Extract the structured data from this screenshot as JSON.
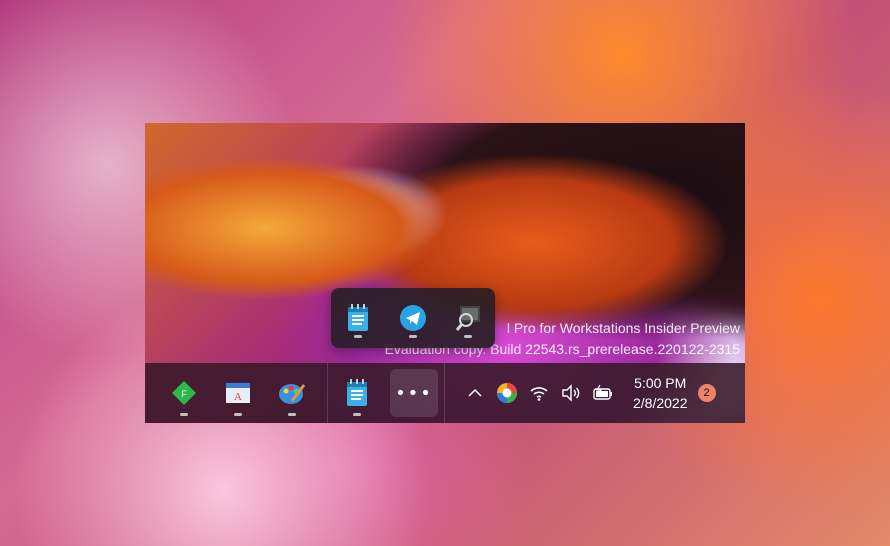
{
  "desktop": {
    "watermark_line1": "l Pro for Workstations Insider Preview",
    "watermark_line2": "Evaluation copy. Build 22543.rs_prerelease.220122-2315"
  },
  "overflow_popup": {
    "items": [
      {
        "icon": "notepad-icon"
      },
      {
        "icon": "telegram-icon"
      },
      {
        "icon": "magnifier-icon"
      }
    ]
  },
  "taskbar": {
    "pinned": [
      {
        "icon": "green-diamond-app-icon",
        "label": "F"
      },
      {
        "icon": "wordpad-icon",
        "label": "A"
      },
      {
        "icon": "paint-icon"
      },
      {
        "icon": "notepad-icon"
      }
    ],
    "overflow_label": "•••",
    "tray": {
      "chevron": "^",
      "icons": [
        "edge-canary-icon",
        "wifi-icon",
        "volume-icon",
        "battery-icon"
      ]
    },
    "clock": {
      "time": "5:00 PM",
      "date": "2/8/2022"
    },
    "notification_count": "2"
  },
  "colors": {
    "accent": "#f0826a",
    "taskbar_bg": "#37192a"
  }
}
